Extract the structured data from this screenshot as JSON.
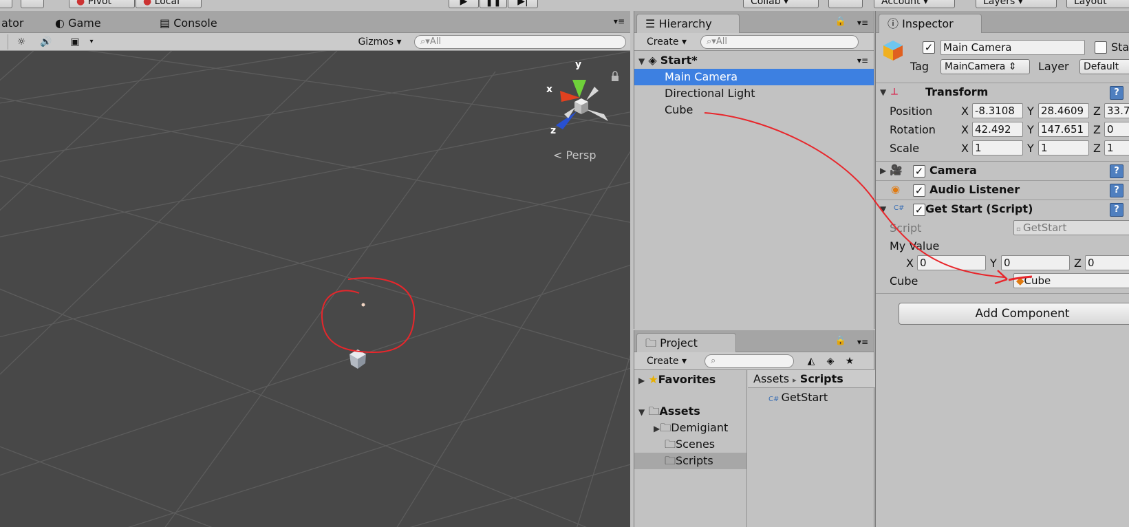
{
  "toolbar": {
    "pivot_label": "Pivot",
    "local_label": "Local",
    "collab_label": "Collab",
    "account_label": "Account",
    "layers_label": "Layers",
    "layout_label": "Layout"
  },
  "scene": {
    "tabs": [
      {
        "label": "ator"
      },
      {
        "label": "Game"
      },
      {
        "label": "Console"
      }
    ],
    "gizmos_label": "Gizmos",
    "search_placeholder": "All",
    "persp_label": "Persp",
    "axis_labels": {
      "x": "x",
      "y": "y",
      "z": "z"
    }
  },
  "hierarchy": {
    "tab_label": "Hierarchy",
    "create_label": "Create",
    "search_placeholder": "All",
    "scene_name": "Start*",
    "items": [
      {
        "label": "Main Camera",
        "selected": true
      },
      {
        "label": "Directional Light",
        "selected": false
      },
      {
        "label": "Cube",
        "selected": false
      }
    ]
  },
  "project": {
    "tab_label": "Project",
    "create_label": "Create",
    "favorites_label": "Favorites",
    "assets_label": "Assets",
    "folders": [
      {
        "label": "Demigiant",
        "selected": false
      },
      {
        "label": "Scenes",
        "selected": false
      },
      {
        "label": "Scripts",
        "selected": true
      }
    ],
    "breadcrumb": {
      "root": "Assets",
      "current": "Scripts"
    },
    "files": [
      {
        "label": "GetStart"
      }
    ]
  },
  "inspector": {
    "tab_label": "Inspector",
    "object_name": "Main Camera",
    "static_label": "Stat",
    "tag_label": "Tag",
    "tag_value": "MainCamera",
    "layer_label": "Layer",
    "layer_value": "Default",
    "transform": {
      "title": "Transform",
      "position": {
        "label": "Position",
        "x": "-8.3108",
        "y": "28.4609",
        "z": "33.7"
      },
      "rotation": {
        "label": "Rotation",
        "x": "42.492",
        "y": "147.651",
        "z": "0"
      },
      "scale": {
        "label": "Scale",
        "x": "1",
        "y": "1",
        "z": "1"
      }
    },
    "camera_title": "Camera",
    "audio_title": "Audio Listener",
    "script_component": {
      "title": "Get Start (Script)",
      "script_label": "Script",
      "script_value": "GetStart",
      "my_value_label": "My Value",
      "x": "0",
      "y": "0",
      "z": "0",
      "cube_label": "Cube",
      "cube_value": "Cube"
    },
    "add_component_label": "Add Component"
  },
  "axis_letters": {
    "x": "X",
    "y": "Y",
    "z": "Z"
  },
  "colors": {
    "selection": "#3d80e1",
    "annotation": "#e8262b",
    "viewport": "#484848"
  }
}
